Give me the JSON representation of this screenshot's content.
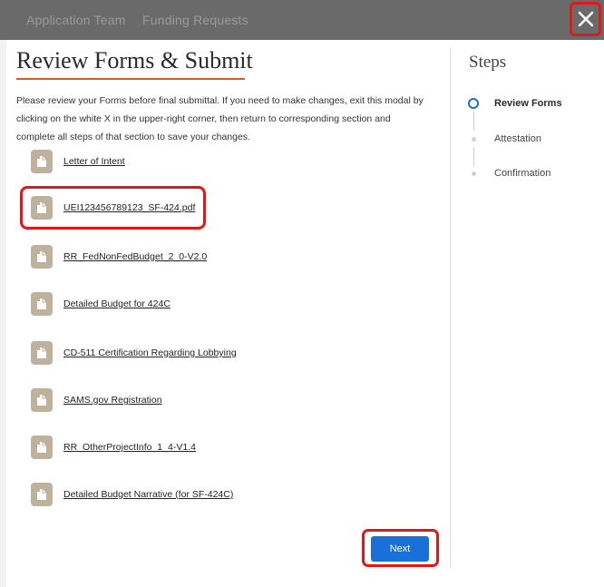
{
  "background": {
    "tabs": [
      "Application Team",
      "Funding Requests"
    ]
  },
  "modal": {
    "title": "Review Forms & Submit",
    "intro": "Please review your Forms before final submittal.  If you need to make changes, exit this modal by clicking on the white X in the upper-right corner, then return to corresponding section and complete all steps of that section to save your changes.",
    "forms": [
      "Letter of Intent",
      "UEI123456789123_SF-424.pdf",
      "RR_FedNonFedBudget_2_0-V2.0",
      "Detailed Budget for 424C",
      "CD-511 Certification Regarding Lobbying",
      "SAMS.gov Registration",
      "RR_OtherProjectInfo_1_4-V1.4",
      "Detailed Budget Narrative (for SF-424C)"
    ],
    "next_label": "Next"
  },
  "steps": {
    "title": "Steps",
    "items": [
      {
        "label": "Review Forms",
        "state": "active"
      },
      {
        "label": "Attestation",
        "state": "pending"
      },
      {
        "label": "Confirmation",
        "state": "pending"
      }
    ]
  },
  "colors": {
    "accent": "#1a6fd8",
    "underline": "#d75a2a",
    "highlight": "#e01818",
    "doc_icon": "#bfb29c"
  },
  "icons": {
    "close": "close-icon",
    "document": "document-icon"
  }
}
